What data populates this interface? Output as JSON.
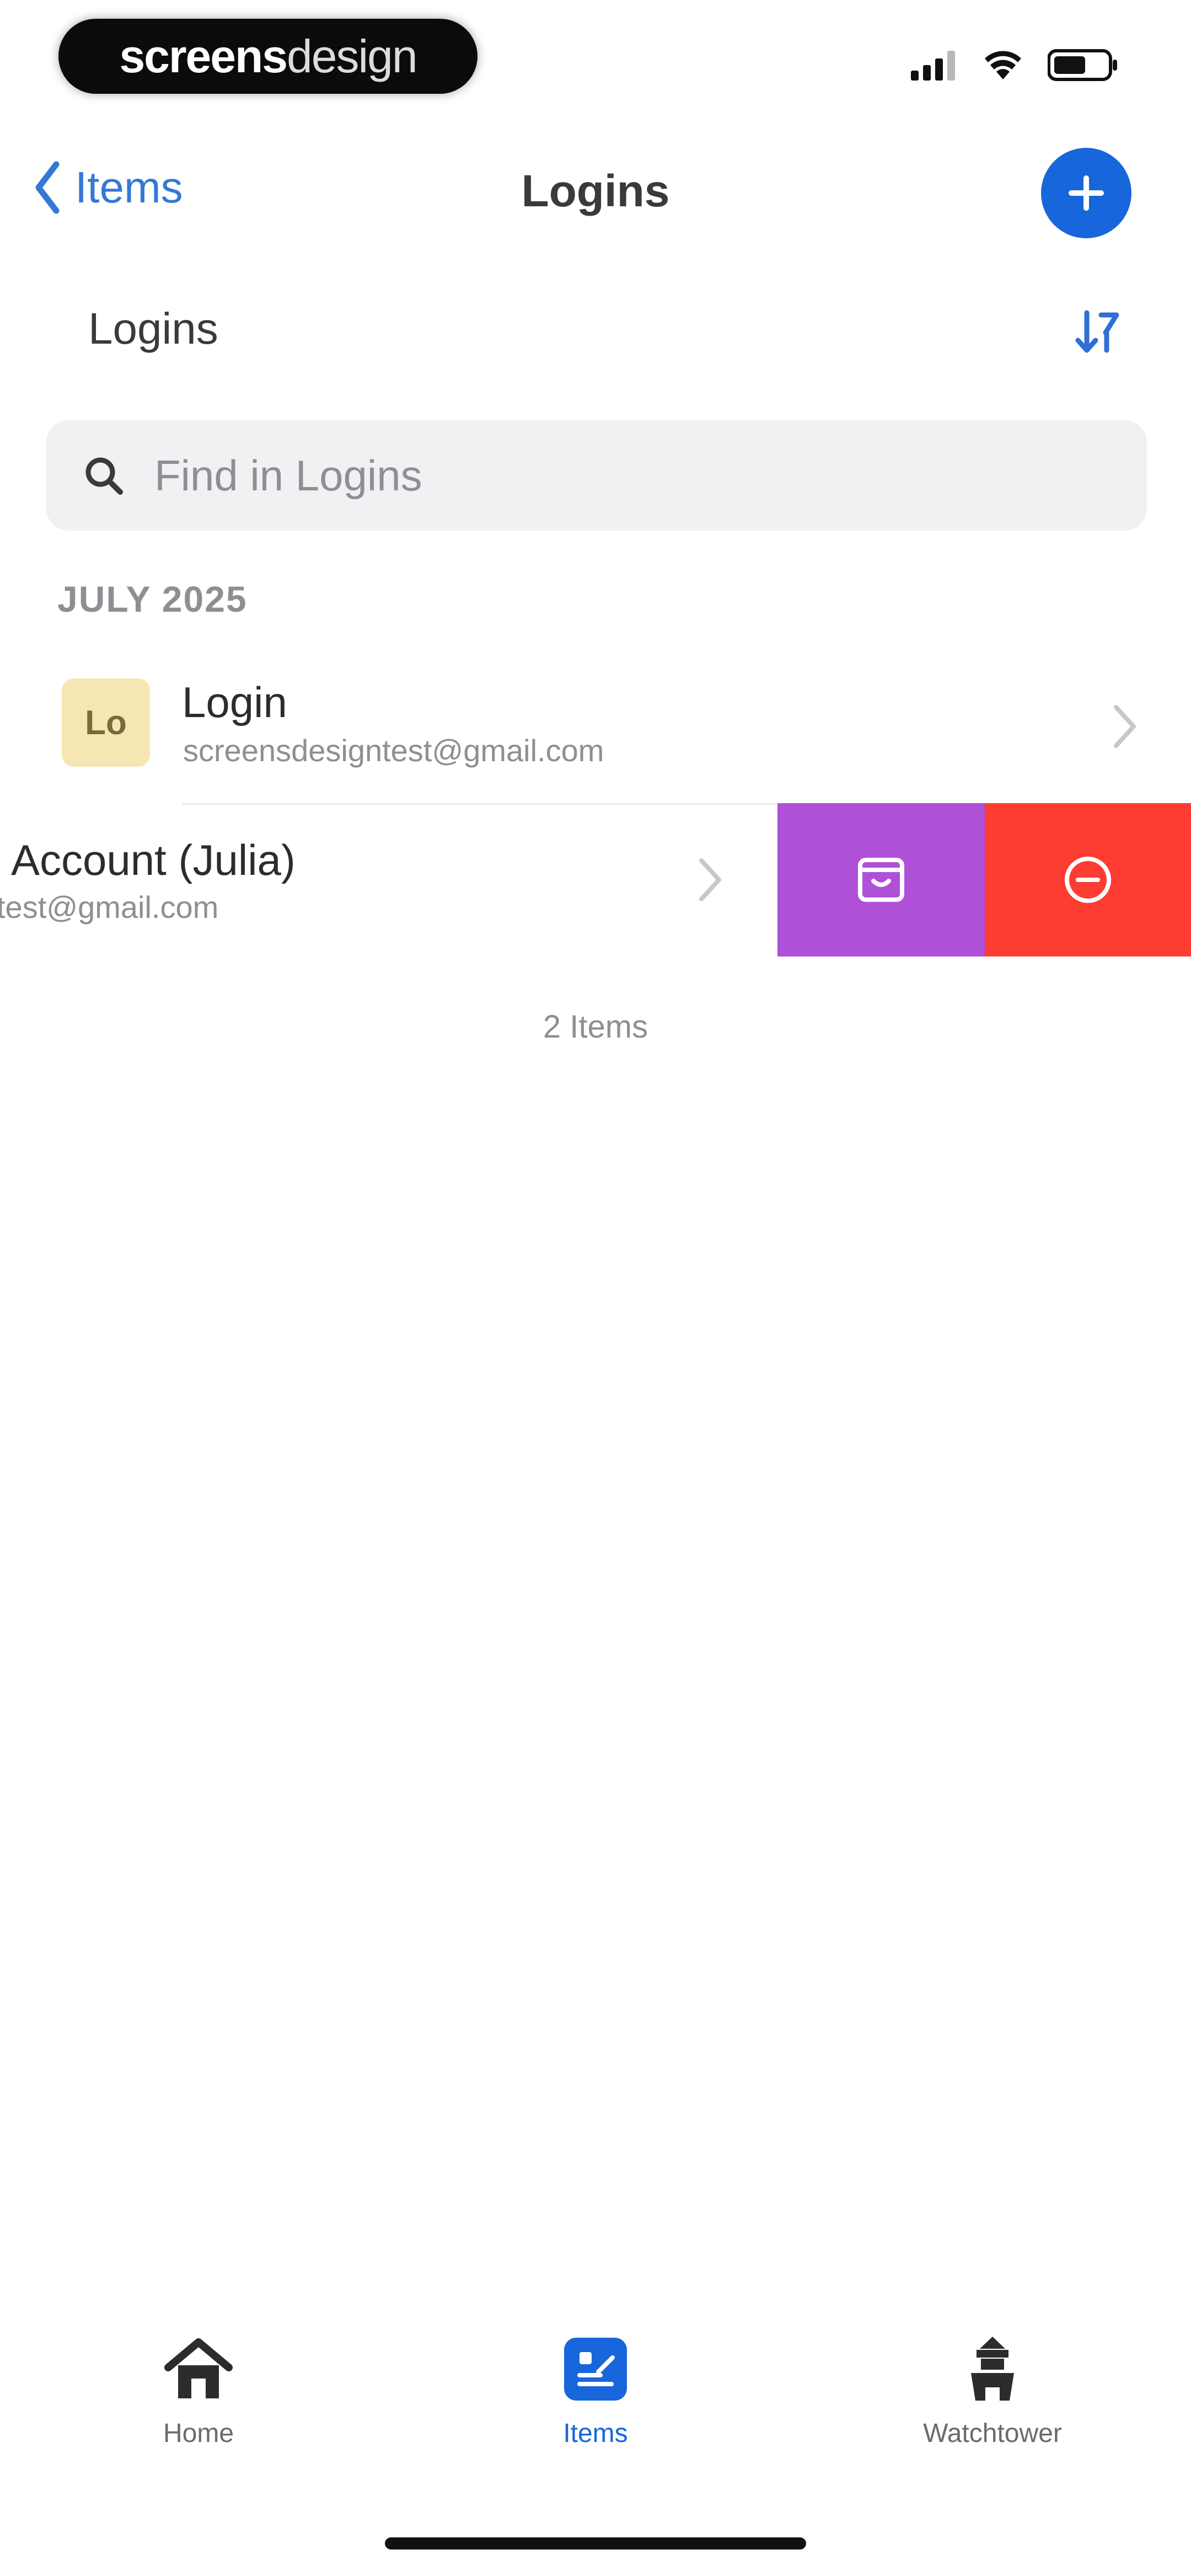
{
  "status_bar": {
    "brand_bold": "screens",
    "brand_light": "design"
  },
  "nav": {
    "back_label": "Items",
    "title": "Logins",
    "add_icon": "plus-icon"
  },
  "section": {
    "title": "Logins",
    "sort_icon": "sort-icon"
  },
  "search": {
    "placeholder": "Find in Logins",
    "value": ""
  },
  "list": {
    "date_header": "JULY 2025",
    "items": [
      {
        "avatar": "Lo",
        "title": "Login",
        "subtitle": "screensdesigntest@gmail.com"
      },
      {
        "title": "Account (Julia)",
        "subtitle": "test@gmail.com"
      }
    ],
    "swipe_actions": [
      {
        "icon": "archive-icon",
        "color": "#AE50D8"
      },
      {
        "icon": "delete-icon",
        "color": "#FD3C32"
      }
    ],
    "count": "2 Items"
  },
  "tabbar": {
    "tabs": [
      {
        "label": "Home",
        "icon": "home-icon"
      },
      {
        "label": "Items",
        "icon": "items-icon",
        "active": true
      },
      {
        "label": "Watchtower",
        "icon": "watchtower-icon"
      }
    ]
  },
  "colors": {
    "accent": "#1766DB",
    "archive": "#AE50D8",
    "delete": "#FD3C32",
    "avatar_bg": "#F6E6B2"
  }
}
